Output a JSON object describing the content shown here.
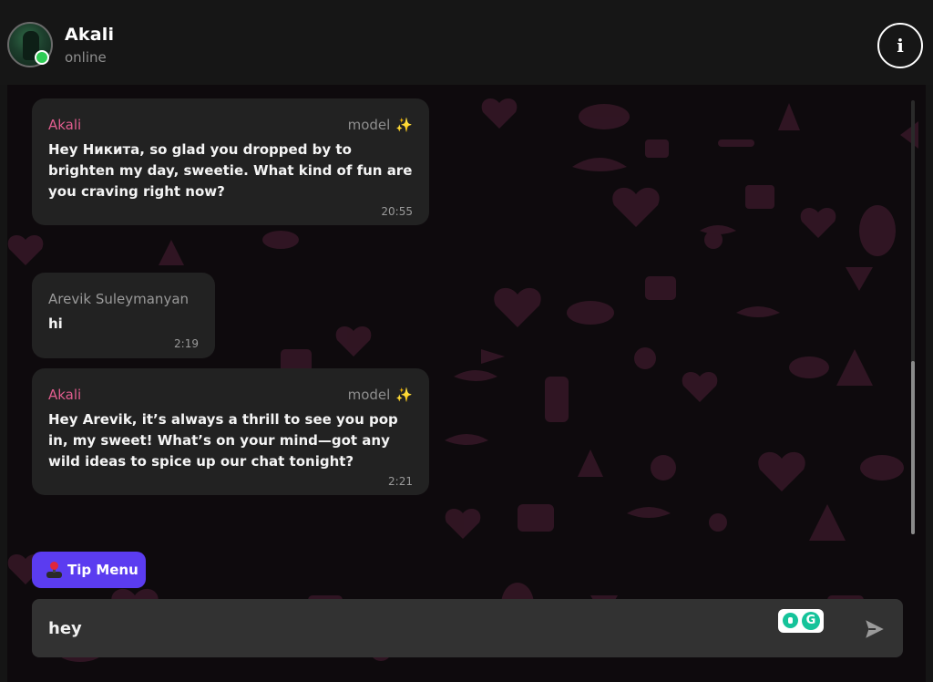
{
  "header": {
    "contact_name": "Akali",
    "status": "online",
    "info_label": "i"
  },
  "messages": [
    {
      "sender": "Akali",
      "tag": "model",
      "tag_icon": "sparkles-icon",
      "text": "Hey Никита, so glad you dropped by to brighten my day, sweetie. What kind of fun are you craving right now?",
      "time": "20:55"
    },
    {
      "sender": "Arevik Suleymanyan",
      "text": "hi",
      "time": "2:19"
    },
    {
      "sender": "Akali",
      "tag": "model",
      "tag_icon": "sparkles-icon",
      "text": "Hey Arevik, it’s always a thrill to see you pop in, my sweet! What’s on your mind—got any wild ideas to spice up our chat tonight?",
      "time": "2:21"
    }
  ],
  "tip_menu": {
    "label": "Tip Menu",
    "icon": "joystick-icon"
  },
  "composer": {
    "value": "hey",
    "send_icon": "send-icon",
    "extension_icon": "grammarly-icon"
  },
  "colors": {
    "accent": "#5b3cf0",
    "model_name": "#e05d8e",
    "online": "#2ecc55",
    "bubble": "#222222",
    "pattern": "#3a1a2b"
  }
}
